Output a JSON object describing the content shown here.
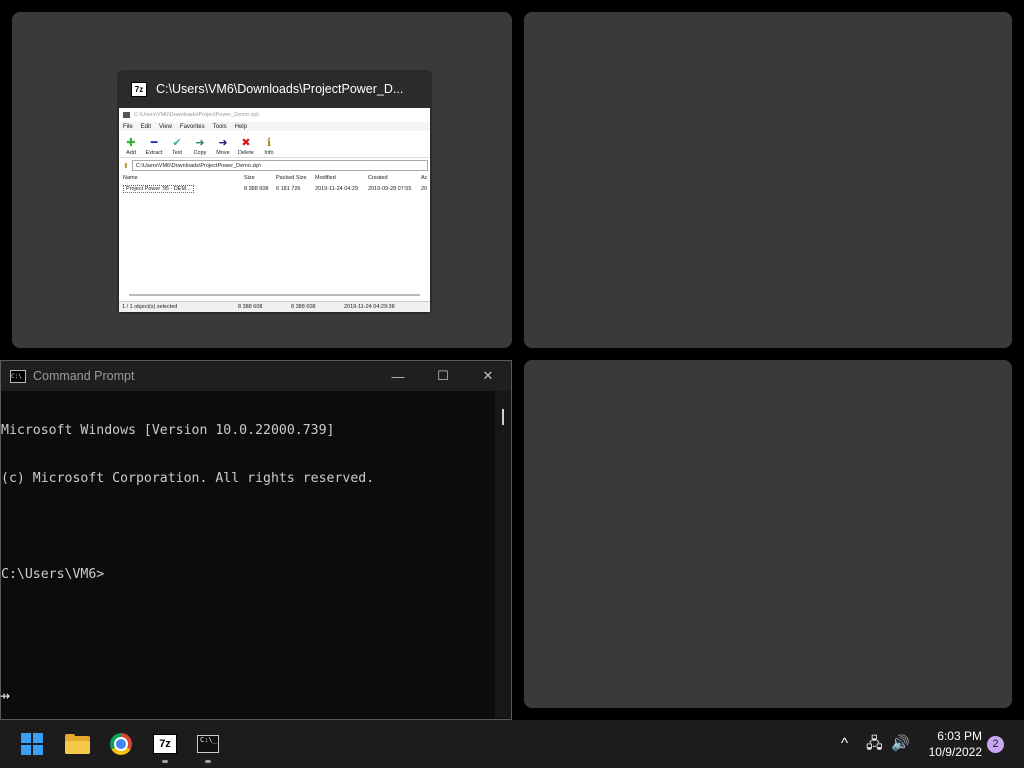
{
  "thumbnail": {
    "title": "C:\\Users\\VM6\\Downloads\\ProjectPower_D...",
    "app_icon": "7z",
    "inner_title": "C:\\Users\\VM6\\Downloads\\ProjectPower_Demo.zip\\",
    "menu": [
      "File",
      "Edit",
      "View",
      "Favorites",
      "Tools",
      "Help"
    ],
    "toolbar": [
      {
        "label": "Add",
        "icon": "plus-icon",
        "glyph": "✚",
        "color": "#2db52d"
      },
      {
        "label": "Extract",
        "icon": "minus-icon",
        "glyph": "━",
        "color": "#1a2bb8"
      },
      {
        "label": "Test",
        "icon": "check-icon",
        "glyph": "✔",
        "color": "#3fa8a8"
      },
      {
        "label": "Copy",
        "icon": "arrow-right-icon",
        "glyph": "➜",
        "color": "#2e7d6e"
      },
      {
        "label": "Move",
        "icon": "arrow-right-icon",
        "glyph": "➜",
        "color": "#1a237e"
      },
      {
        "label": "Delete",
        "icon": "x-icon",
        "glyph": "✖",
        "color": "#d21d1d"
      },
      {
        "label": "Info",
        "icon": "info-icon",
        "glyph": "ℹ",
        "color": "#b08a10"
      }
    ],
    "address": "C:\\Users\\VM6\\Downloads\\ProjectPower_Demo.zip\\",
    "columns": {
      "name": "Name",
      "size": "Size",
      "packed": "Packed Size",
      "modified": "Modified",
      "created": "Created",
      "accessed": "Ac"
    },
    "row": {
      "name": "Project Power '95 - DEM...",
      "size": "8 388 608",
      "packed": "6 181 726",
      "modified": "2019-11-24 04:29",
      "created": "2019-09-28 07:55",
      "accessed": "20"
    },
    "status": {
      "selected": "1 / 1 object(s) selected",
      "size": "8 388 608",
      "packed": "8 388 608",
      "date": "2019-11-24 04:29:38"
    }
  },
  "cmd": {
    "title": "Command Prompt",
    "icon_text": "C:\\",
    "lines": [
      "Microsoft Windows [Version 10.0.22000.739]",
      "(c) Microsoft Corporation. All rights reserved.",
      "",
      "C:\\Users\\VM6>"
    ],
    "buttons": {
      "minimize": "—",
      "maximize": "☐",
      "close": "✕"
    }
  },
  "taskbar": {
    "apps": [
      "start",
      "file-explorer",
      "chrome",
      "7-zip",
      "command-prompt"
    ],
    "icon_7z": "7z",
    "term_text": "C:\\_",
    "tray": {
      "chevron": "^",
      "network": "🖧",
      "volume": "🔊"
    },
    "time": "6:03 PM",
    "date": "10/9/2022",
    "notifications": "2"
  }
}
